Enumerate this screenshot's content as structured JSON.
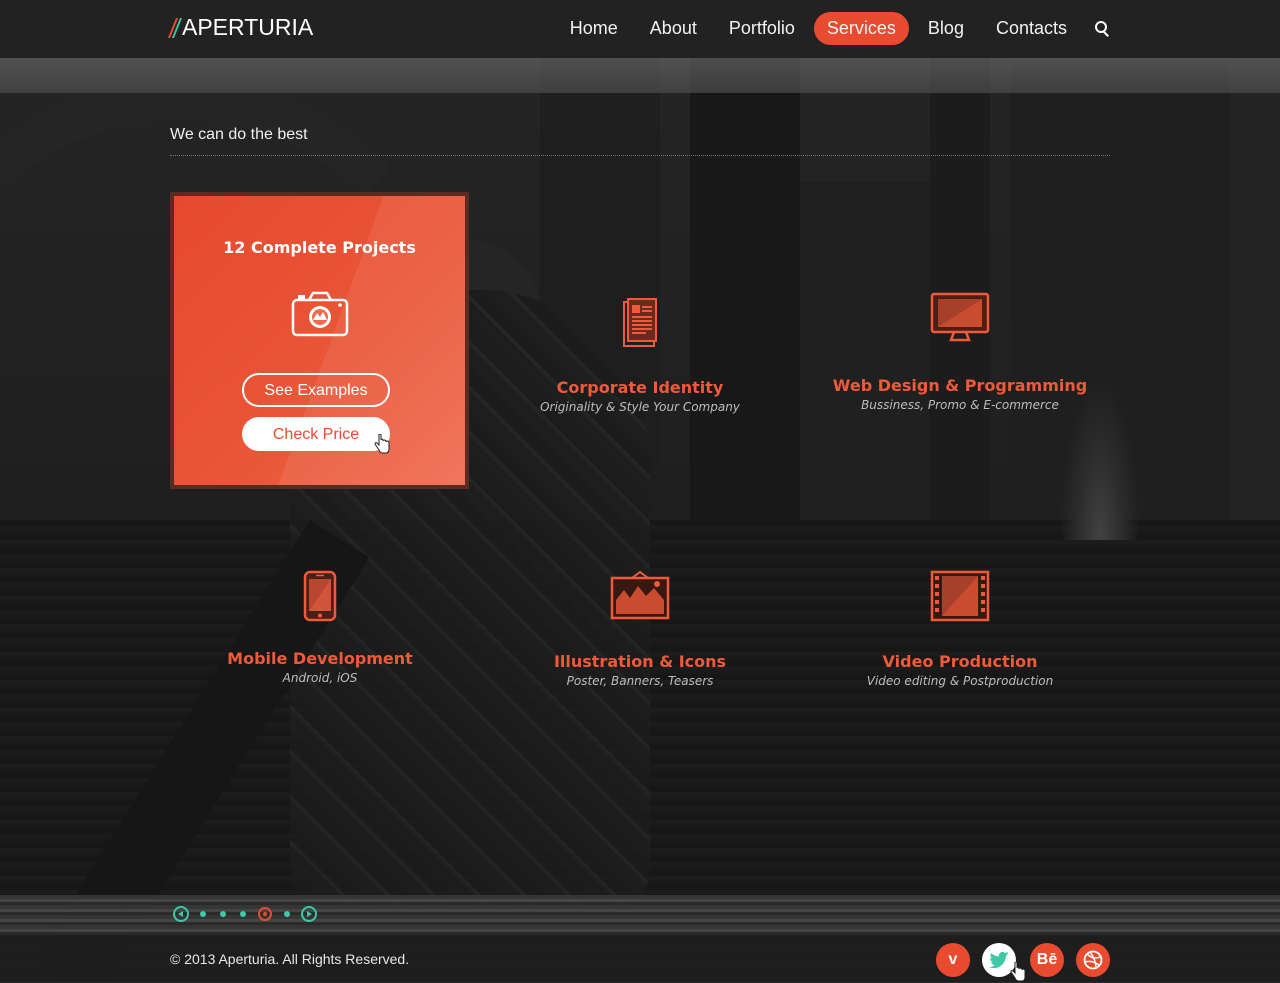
{
  "brand": {
    "name": "APERTURIA",
    "accent": "#e84b2f",
    "secondary": "#3fc8a8"
  },
  "nav": {
    "items": [
      {
        "label": "Home"
      },
      {
        "label": "About"
      },
      {
        "label": "Portfolio"
      },
      {
        "label": "Services",
        "active": true
      },
      {
        "label": "Blog"
      },
      {
        "label": "Contacts"
      }
    ],
    "search_icon": "search-icon"
  },
  "section": {
    "title": "We can do the best"
  },
  "featured": {
    "title": "12 Complete Projects",
    "icon": "camera-icon",
    "primary_button": "See Examples",
    "secondary_button": "Check Price"
  },
  "services": [
    {
      "title": "Corporate Identity",
      "subtitle": "Originality & Style Your Company",
      "icon": "document-icon"
    },
    {
      "title": "Web Design & Programming",
      "subtitle": "Bussiness, Promo & E-commerce",
      "icon": "monitor-icon"
    },
    {
      "title": "Mobile Development",
      "subtitle": "Android, iOS",
      "icon": "smartphone-icon"
    },
    {
      "title": "Illustration & Icons",
      "subtitle": "Poster, Banners, Teasers",
      "icon": "picture-icon"
    },
    {
      "title": "Video Production",
      "subtitle": "Video editing & Postproduction",
      "icon": "film-icon"
    }
  ],
  "pager": {
    "dot_count": 5,
    "active_index": 3
  },
  "footer": {
    "copyright": "© 2013 Aperturia. All Rights Reserved.",
    "social": [
      {
        "name": "vimeo-icon",
        "glyph": "v"
      },
      {
        "name": "twitter-icon",
        "glyph": ""
      },
      {
        "name": "behance-icon",
        "glyph": "Bē"
      },
      {
        "name": "dribbble-icon",
        "glyph": ""
      }
    ]
  }
}
